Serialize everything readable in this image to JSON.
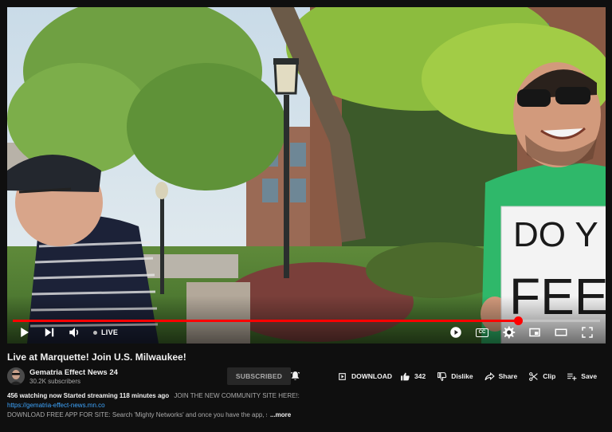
{
  "player": {
    "live_label": "LIVE",
    "progress_fraction": 0.86,
    "cc_label": "CC"
  },
  "sign": {
    "line1": "DO Y",
    "line2": "FEEL"
  },
  "video": {
    "title": "Live at Marquette! Join U.S. Milwaukee!"
  },
  "channel": {
    "name": "Gematria Effect News 24",
    "subscribers": "30.2K subscribers",
    "subscribe_label": "SUBSCRIBED"
  },
  "actions": {
    "download": "DOWNLOAD",
    "likes": "342",
    "dislike": "Dislike",
    "share": "Share",
    "clip": "Clip",
    "save": "Save"
  },
  "description": {
    "stats": "456 watching now  Started streaming 118 minutes ago",
    "promo": "JOIN THE NEW COMMUNITY SITE HERE!:",
    "link": "https://gematria-effect-news.mn.co",
    "line3": "DOWNLOAD FREE APP FOR SITE: Search 'Mighty Networks' and once you have the app, search",
    "more": "...more"
  },
  "colors": {
    "background": "#0f0f0f",
    "progress": "#ff0000",
    "link": "#3ea6ff",
    "shirt": "#2fb86a"
  }
}
